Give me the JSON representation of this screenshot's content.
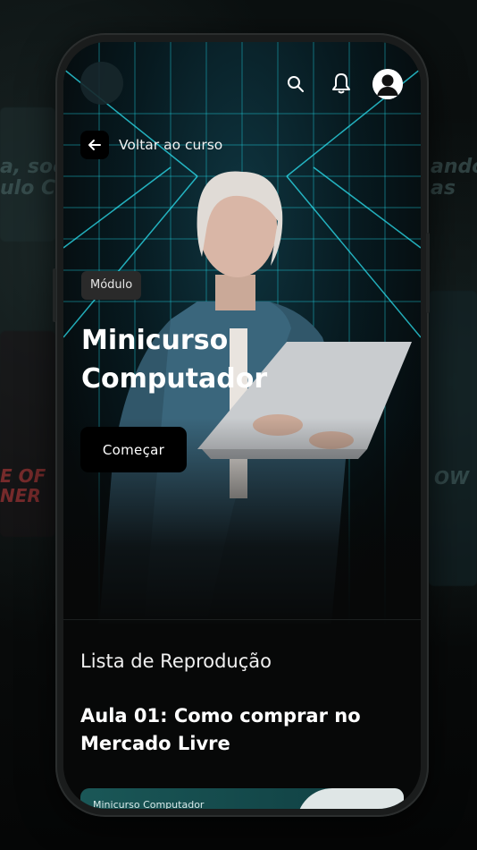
{
  "background": {
    "left_text_1": "a, soc",
    "left_text_2": "ulo Co",
    "right_text_1": "ando",
    "right_text_2": "as",
    "left_lower_text": "E OF",
    "left_lower_text_2": "NER",
    "right_lower_text": "OW"
  },
  "header": {
    "search_icon": "search-icon",
    "bell_icon": "bell-icon",
    "avatar_icon": "user-avatar-icon"
  },
  "back": {
    "label": "Voltar ao curso",
    "icon": "arrow-left-icon"
  },
  "hero": {
    "badge": "Módulo",
    "title": "Minicurso Computador",
    "start_label": "Começar"
  },
  "playlist": {
    "heading": "Lista de Reprodução",
    "lesson_title": "Aula 01: Como comprar no Mercado Livre",
    "thumb_label": "Minicurso Computador"
  },
  "colors": {
    "accent_grid": "#1fd6e6",
    "background": "#070808",
    "button_bg": "#000000"
  }
}
